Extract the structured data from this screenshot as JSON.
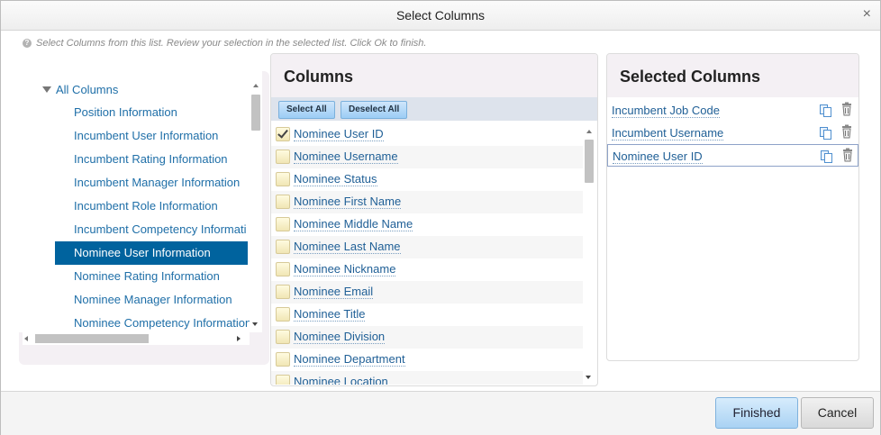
{
  "dialog": {
    "title": "Select Columns",
    "close_symbol": "×",
    "hint_icon": "?",
    "hint": "Select Columns from this list. Review your selection in the selected list. Click Ok to finish."
  },
  "tree": {
    "root_label": "All Columns",
    "items": [
      {
        "label": "Position Information",
        "selected": false
      },
      {
        "label": "Incumbent User Information",
        "selected": false
      },
      {
        "label": "Incumbent Rating Information",
        "selected": false
      },
      {
        "label": "Incumbent Manager Information",
        "selected": false
      },
      {
        "label": "Incumbent Role Information",
        "selected": false
      },
      {
        "label": "Incumbent Competency Informati",
        "selected": false
      },
      {
        "label": "Nominee User Information",
        "selected": true
      },
      {
        "label": "Nominee Rating Information",
        "selected": false
      },
      {
        "label": "Nominee Manager Information",
        "selected": false
      },
      {
        "label": "Nominee Competency Information",
        "selected": false
      }
    ]
  },
  "columns_panel": {
    "title": "Columns",
    "select_all_label": "Select All",
    "deselect_all_label": "Deselect All",
    "rows": [
      {
        "label": "Nominee User ID",
        "checked": true
      },
      {
        "label": "Nominee Username",
        "checked": false
      },
      {
        "label": "Nominee Status",
        "checked": false
      },
      {
        "label": "Nominee First Name",
        "checked": false
      },
      {
        "label": "Nominee Middle Name",
        "checked": false
      },
      {
        "label": "Nominee Last Name",
        "checked": false
      },
      {
        "label": "Nominee Nickname",
        "checked": false
      },
      {
        "label": "Nominee Email",
        "checked": false
      },
      {
        "label": "Nominee Title",
        "checked": false
      },
      {
        "label": "Nominee Division",
        "checked": false
      },
      {
        "label": "Nominee Department",
        "checked": false
      },
      {
        "label": "Nominee Location",
        "checked": false
      }
    ]
  },
  "selected_panel": {
    "title": "Selected Columns",
    "rows": [
      {
        "label": "Incumbent Job Code",
        "active": false
      },
      {
        "label": "Incumbent Username",
        "active": false
      },
      {
        "label": "Nominee User ID",
        "active": true
      }
    ]
  },
  "footer": {
    "finished_label": "Finished",
    "cancel_label": "Cancel"
  }
}
